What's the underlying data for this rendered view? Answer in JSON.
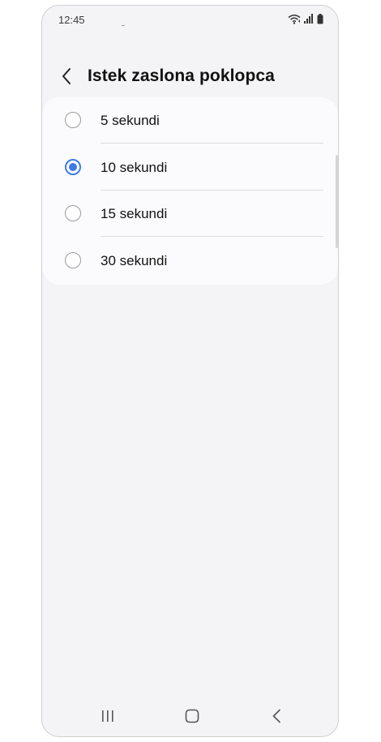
{
  "status_bar": {
    "time": "12:45",
    "icons": [
      "wifi-icon",
      "signal-icon",
      "battery-icon"
    ]
  },
  "header": {
    "title": "Istek zaslona poklopca",
    "back_icon": "back-arrow-icon"
  },
  "options": [
    {
      "label": "5 sekundi",
      "selected": false
    },
    {
      "label": "10 sekundi",
      "selected": true
    },
    {
      "label": "15 sekundi",
      "selected": false
    },
    {
      "label": "30 sekundi",
      "selected": false
    }
  ],
  "nav_bar": {
    "icons": [
      "recents-icon",
      "home-icon",
      "back-icon"
    ]
  },
  "colors": {
    "accent": "#3e7be6",
    "background": "#f4f4f6",
    "card": "#fbfbfd"
  }
}
